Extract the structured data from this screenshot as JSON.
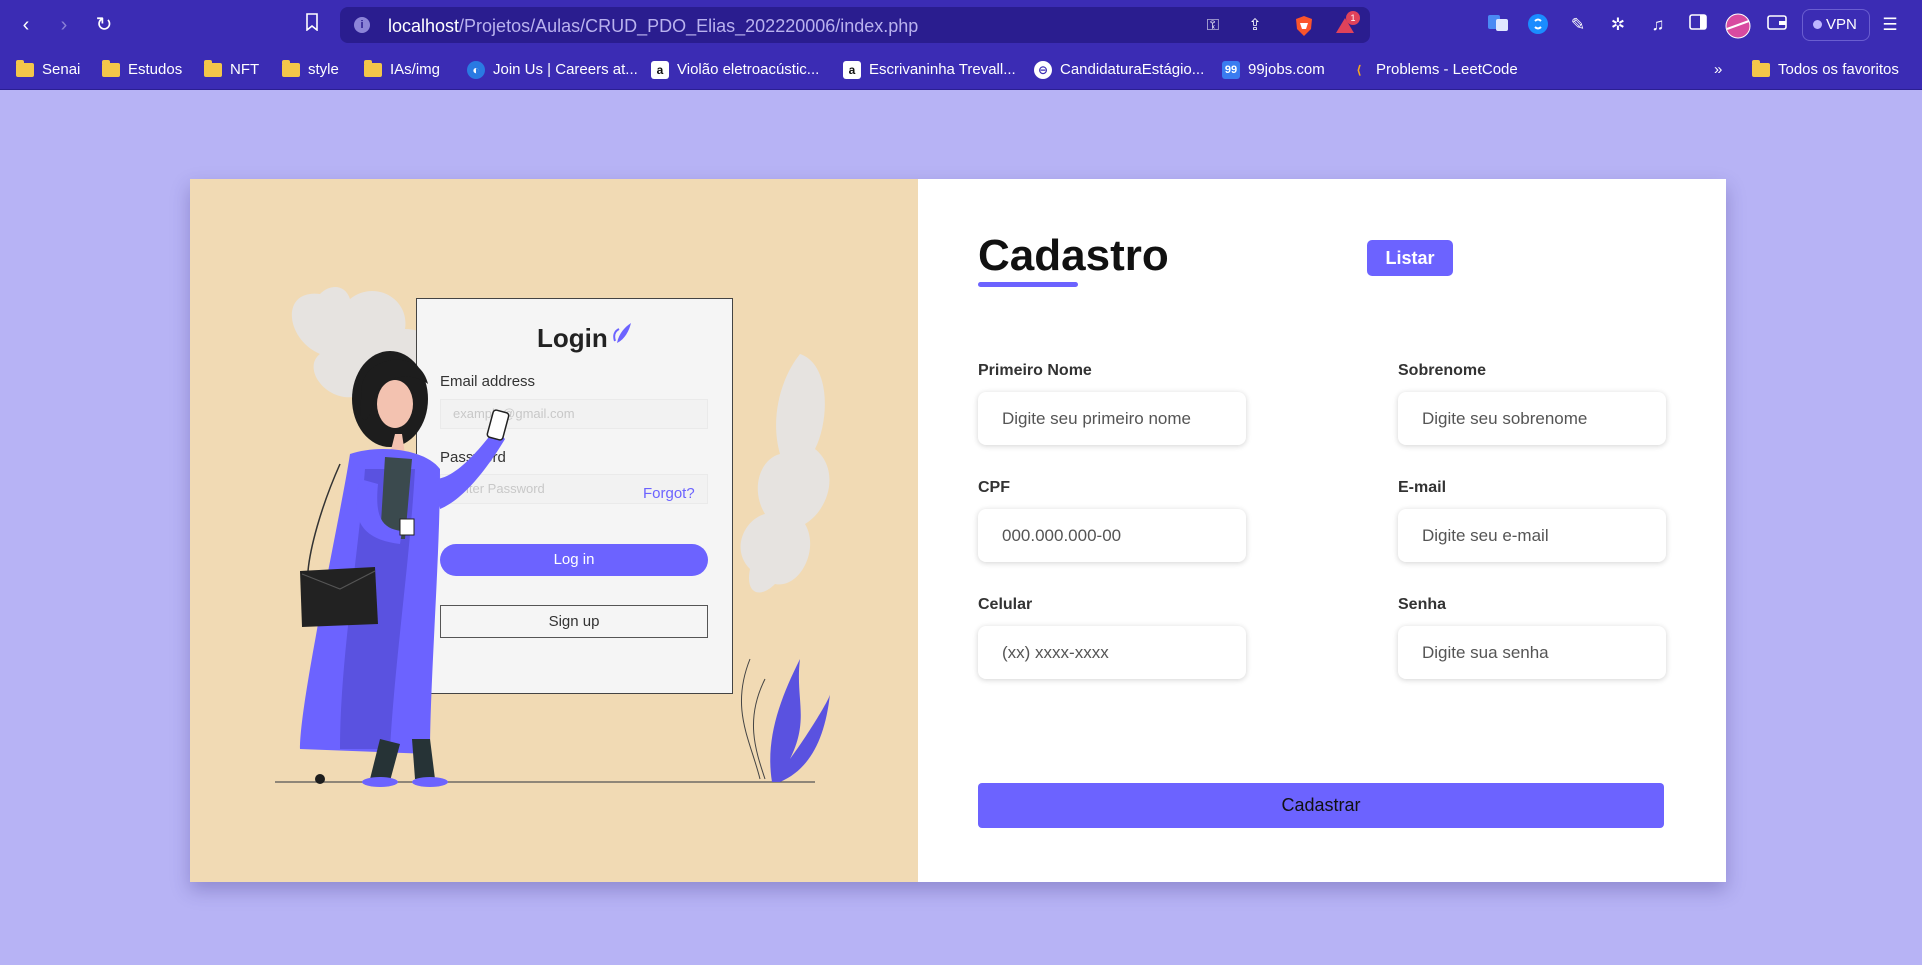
{
  "browser": {
    "url_host": "localhost",
    "url_path": "/Projetos/Aulas/CRUD_PDO_Elias_202220006/index.php",
    "vpn_label": "VPN",
    "brave_badge": "1",
    "bookmarks": [
      {
        "label": "Senai",
        "icon": "folder-icon"
      },
      {
        "label": "Estudos",
        "icon": "folder-icon"
      },
      {
        "label": "NFT",
        "icon": "folder-icon"
      },
      {
        "label": "style",
        "icon": "folder-icon"
      },
      {
        "label": "IAs/img",
        "icon": "folder-icon"
      },
      {
        "label": "Join Us | Careers at...",
        "icon": "globe-icon"
      },
      {
        "label": "Violão eletroacústic...",
        "icon": "amazon-icon"
      },
      {
        "label": "Escrivaninha Trevall...",
        "icon": "amazon-icon"
      },
      {
        "label": "CandidaturaEstágio...",
        "icon": "form-icon"
      },
      {
        "label": "99jobs.com",
        "icon": "99jobs-icon"
      },
      {
        "label": "Problems - LeetCode",
        "icon": "leetcode-icon"
      }
    ],
    "more_bookmarks": "»",
    "all_favorites": "Todos os favoritos"
  },
  "illustration": {
    "login_title": "Login",
    "email_label": "Email address",
    "email_placeholder": "example@gmail.com",
    "password_label": "Password",
    "password_placeholder": "Enter Password",
    "forgot_label": "Forgot?",
    "login_button": "Log in",
    "signup_button": "Sign up"
  },
  "form": {
    "title": "Cadastro",
    "list_button": "Listar",
    "fields": {
      "first_name": {
        "label": "Primeiro Nome",
        "placeholder": "Digite seu primeiro nome"
      },
      "last_name": {
        "label": "Sobrenome",
        "placeholder": "Digite seu sobrenome"
      },
      "cpf": {
        "label": "CPF",
        "placeholder": "000.000.000-00"
      },
      "email": {
        "label": "E-mail",
        "placeholder": "Digite seu e-mail"
      },
      "phone": {
        "label": "Celular",
        "placeholder": "(xx) xxxx-xxxx"
      },
      "password": {
        "label": "Senha",
        "placeholder": "Digite sua senha"
      }
    },
    "submit_button": "Cadastrar"
  },
  "colors": {
    "accent": "#6c63ff",
    "page_bg": "#b7b3f5",
    "chrome_bg": "#3b2cb4",
    "illustration_bg": "#f1dab4"
  }
}
